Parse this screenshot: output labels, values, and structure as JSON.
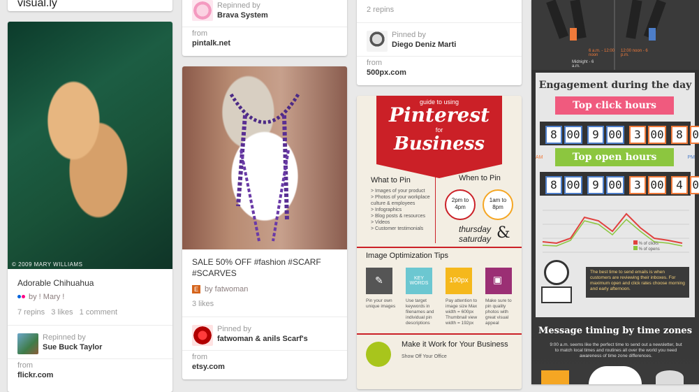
{
  "colors": {
    "accent_red": "#cb2027",
    "pin_gray": "#f0f0f0"
  },
  "col1": {
    "top_card": {
      "text": "visual.ly"
    },
    "chihuahua": {
      "photo_credit": "© 2009 MARY WILLIAMS",
      "title": "Adorable Chihuahua",
      "by": "by ! Mary !",
      "stats": "7 repins   3 likes   1 comment",
      "repinned_label": "Repinned by",
      "repinned_name": "Sue Buck Taylor",
      "from_label": "from",
      "from_site": "flickr.com"
    }
  },
  "col2": {
    "top_card": {
      "repinned_label": "Repinned by",
      "repinned_name": "Brava System",
      "from_label": "from",
      "from_site": "pintalk.net"
    },
    "scarf": {
      "title": "SALE 50% OFF #fashion #SCARF #SCARVES",
      "by": "by fatwoman",
      "likes": "3 likes",
      "pinned_label": "Pinned by",
      "pinned_name": "fatwoman & anils Scarf's",
      "from_label": "from",
      "from_site": "etsy.com"
    }
  },
  "col3": {
    "top_card": {
      "repins": "2 repins",
      "pinned_label": "Pinned by",
      "pinned_name": "Diego Deniz Marti",
      "from_label": "from",
      "from_site": "500px.com"
    },
    "infographic": {
      "guide": "guide to using",
      "pinterest": "Pinterest",
      "for": "for",
      "business": "Business",
      "what_to_pin": "What to Pin",
      "what_list": [
        "> Images of your product",
        "> Photos of your workplace culture & employees",
        "> Infographics",
        "> Blog posts & resources",
        "> Videos",
        "> Customer testimonials"
      ],
      "when_to_pin": "When to Pin",
      "time1": "2pm to 4pm",
      "time2": "1am to 8pm",
      "thursday": "thursday",
      "saturday": "saturday",
      "amp": "&",
      "image_tips": "Image Optimization Tips",
      "tip1": "Pin your own unique images",
      "tip2": "Use target keywords in filenames and individual pin descriptions",
      "tip3": "Pay attention to image size Max width = 600px Thumbnail view width = 192px",
      "tip4": "Make sure to pin quality photos with great visual appeal",
      "key_words": "KEY WORDS",
      "size_px": "190px",
      "make_it_work": "Make it Work for Your Business",
      "show_office": "Show Off Your Office"
    }
  },
  "col4": {
    "engagement": "Engagement during the day",
    "top_click": "Top click hours",
    "top_open": "Top open hours",
    "click_times": [
      "8",
      "00",
      "9",
      "00",
      "3",
      "00",
      "8",
      "00"
    ],
    "open_times": [
      "8",
      "00",
      "9",
      "00",
      "3",
      "00",
      "4",
      "00"
    ],
    "am": "AM",
    "pm": "PM",
    "legend_clicks": "% of clicks",
    "legend_opens": "% of opens",
    "best_time_text": "The best time to send emails is when customers are reviewing their inboxes. For maximum open and click rates choose morning and early afternoon.",
    "message_timing": "Message timing by time zones",
    "time_zone_text": "9:00 a.m. seems like the perfect time to send out a newsletter, but to match local times and routines all over the world you need awareness of time zone differences.",
    "small_labels": [
      "6 a.m. - 12:00 noon",
      "12:00 noon - 6 p.m.",
      "Midnight - 6 a.m."
    ]
  }
}
